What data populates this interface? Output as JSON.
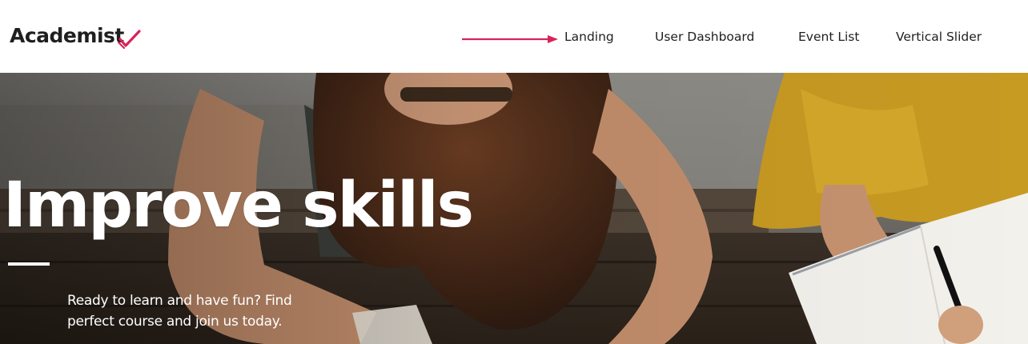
{
  "brand": {
    "name": "Academist",
    "accent_color": "#d6245a",
    "checkmark_icon": "check-icon"
  },
  "nav": {
    "pointer_icon": "arrow-right-icon",
    "items": [
      {
        "label": "Landing"
      },
      {
        "label": "User Dashboard"
      },
      {
        "label": "Event List"
      },
      {
        "label": "Vertical Slider"
      }
    ]
  },
  "hero": {
    "title": "Improve skills",
    "subtitle_line1": "Ready to learn and have fun? Find",
    "subtitle_line2": "perfect course and join us today.",
    "text_color": "#ffffff"
  }
}
